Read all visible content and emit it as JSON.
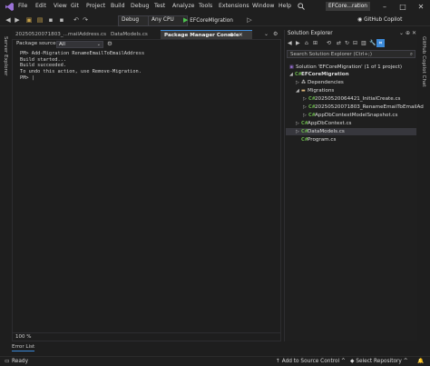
{
  "window": {
    "title": "EFCore...ration"
  },
  "menu": [
    "File",
    "Edit",
    "View",
    "Git",
    "Project",
    "Build",
    "Debug",
    "Test",
    "Analyze",
    "Tools",
    "Extensions",
    "Window",
    "Help"
  ],
  "toolbar": {
    "config": "Debug",
    "platform": "Any CPU",
    "run_target": "EFCoreMigration",
    "copilot": "GitHub Copilot"
  },
  "side_left": {
    "server_explorer": "Server Explorer"
  },
  "side_right": {
    "copilot_chat": "GitHub Copilot Chat"
  },
  "doc_tabs": [
    {
      "label": "20250520071803_...mailAddress.cs"
    },
    {
      "label": "DataModels.cs"
    },
    {
      "label": "Package Manager Console"
    }
  ],
  "pmc": {
    "source_label": "Package source:",
    "source_value": "All",
    "console_text": "PM> Add-Migration RenameEmailToEmailAddress\nBuild started...\nBuild succeeded.\nTo undo this action, use Remove-Migration.\nPM> |",
    "zoom": "100 %"
  },
  "solution_explorer": {
    "title": "Solution Explorer",
    "search_placeholder": "Search Solution Explorer (Ctrl+;)",
    "items": [
      {
        "label": "Solution 'EFCoreMigration' (1 of 1 project)"
      },
      {
        "label": "EFCoreMigration"
      },
      {
        "label": "Dependencies"
      },
      {
        "label": "Migrations"
      },
      {
        "label": "20250520064421_InitialCreate.cs"
      },
      {
        "label": "20250520071803_RenameEmailToEmailAd"
      },
      {
        "label": "AppDbContextModelSnapshot.cs"
      },
      {
        "label": "AppDbContext.cs"
      },
      {
        "label": "DataModels.cs"
      },
      {
        "label": "Program.cs"
      }
    ]
  },
  "bottom": {
    "error_list": "Error List"
  },
  "status": {
    "ready": "Ready",
    "source_control": "Add to Source Control",
    "repository": "Select Repository"
  },
  "colors": {
    "accent": "#3c8ad8",
    "selected": "#37373d",
    "cs_icon": "#68b04b",
    "folder": "#dcb67a"
  }
}
